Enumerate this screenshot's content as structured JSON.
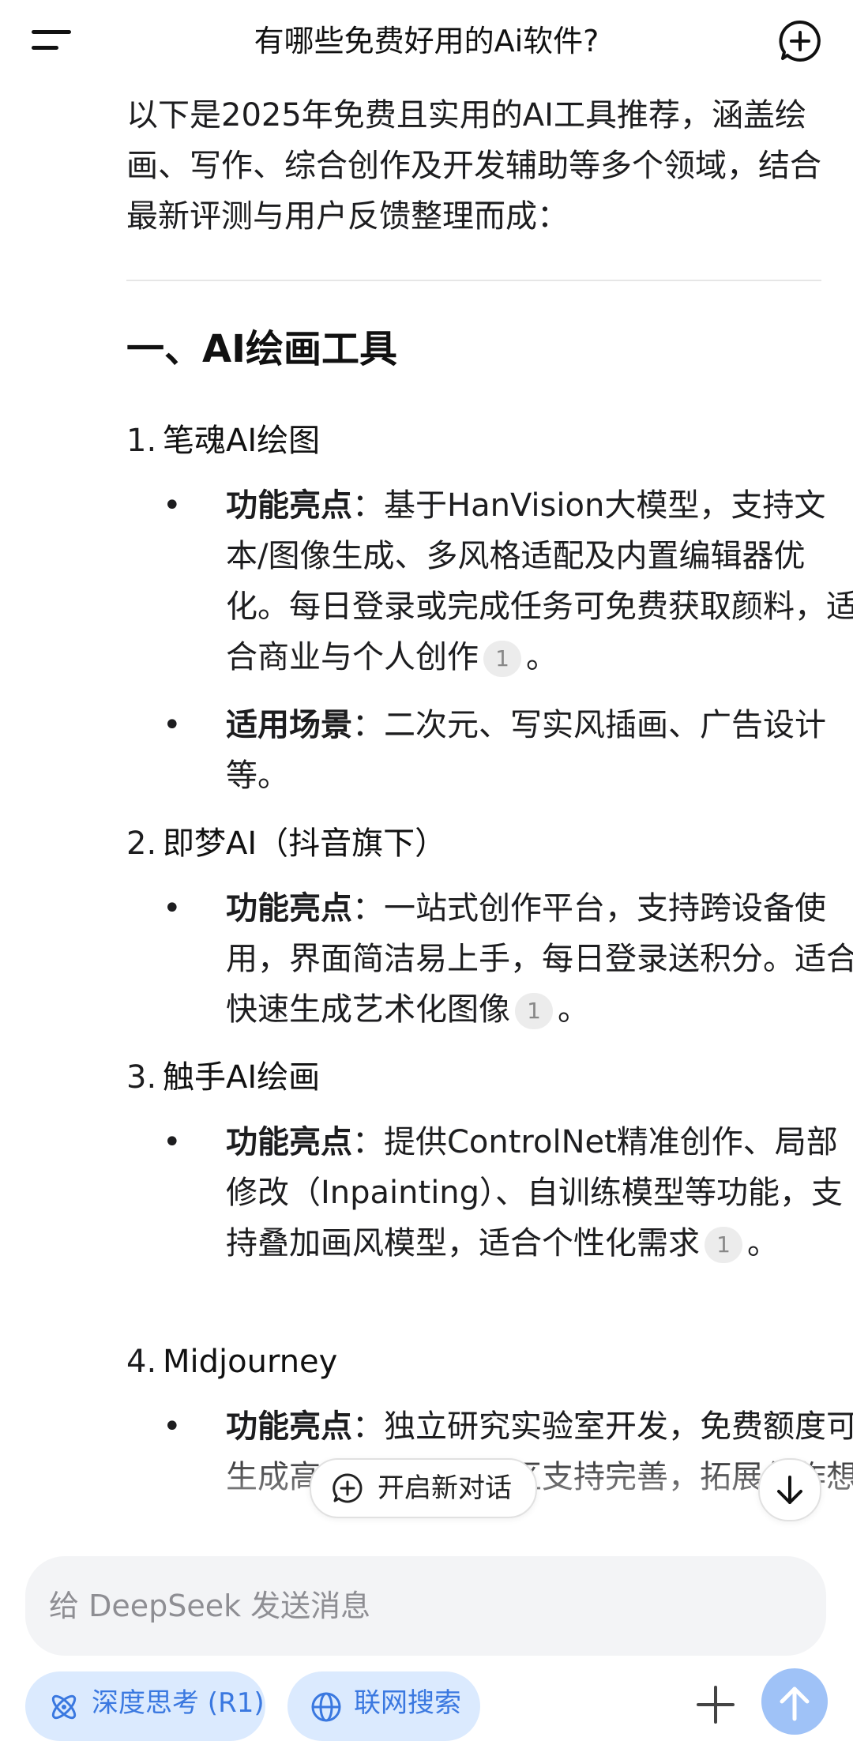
{
  "header": {
    "title": "有哪些免费好用的Ai软件?",
    "menu_icon": "menu-icon",
    "new_chat_icon": "chat-plus-icon"
  },
  "message": {
    "intro": "以下是2025年免费且实用的AI工具推荐，涵盖绘画、写作、综合创作及开发辅助等多个领域，结合最新评测与用户反馈整理而成：",
    "section_title": "一、AI绘画工具",
    "items": [
      {
        "num": "1.",
        "title": "笔魂AI绘图",
        "bullets": [
          {
            "label": "功能亮点",
            "sep": "：",
            "text": "基于HanVision大模型，支持文本/图像生成、多风格适配及内置编辑器优化。每日登录或完成任务可免费获取颜料，适合商业与个人创作",
            "cite": "1",
            "end": "。"
          },
          {
            "label": "适用场景",
            "sep": "：",
            "text": "二次元、写实风插画、广告设计等。"
          }
        ]
      },
      {
        "num": "2.",
        "title": "即梦AI（抖音旗下）",
        "bullets": [
          {
            "label": "功能亮点",
            "sep": "：",
            "text": "一站式创作平台，支持跨设备使用，界面简洁易上手，每日登录送积分。适合快速生成艺术化图像",
            "cite": "1",
            "end": "。"
          }
        ]
      },
      {
        "num": "3.",
        "title": "触手AI绘画",
        "bullets": [
          {
            "label": "功能亮点",
            "sep": "：",
            "text": "提供ControlNet精准创作、局部修改（Inpainting）、自训练模型等功能，支持叠加画风模型，适合个性化需求",
            "cite": "1",
            "end": "。"
          }
        ]
      },
      {
        "num": "4.",
        "title": "Midjourney",
        "bullets": [
          {
            "label": "功能亮点",
            "sep": "：",
            "text": "独立研究实验室开发，免费额度可生成高质量图像，社区支持完善，拓展创作想"
          }
        ]
      }
    ]
  },
  "floating": {
    "new_chat_label": "开启新对话",
    "scroll_icon": "arrow-down-icon"
  },
  "composer": {
    "placeholder": "给 DeepSeek 发送消息",
    "deep_think_label": "深度思考 (R1)",
    "web_search_label": "联网搜索",
    "accent": "#3a78e0",
    "chip_bg": "#dbeafe"
  }
}
